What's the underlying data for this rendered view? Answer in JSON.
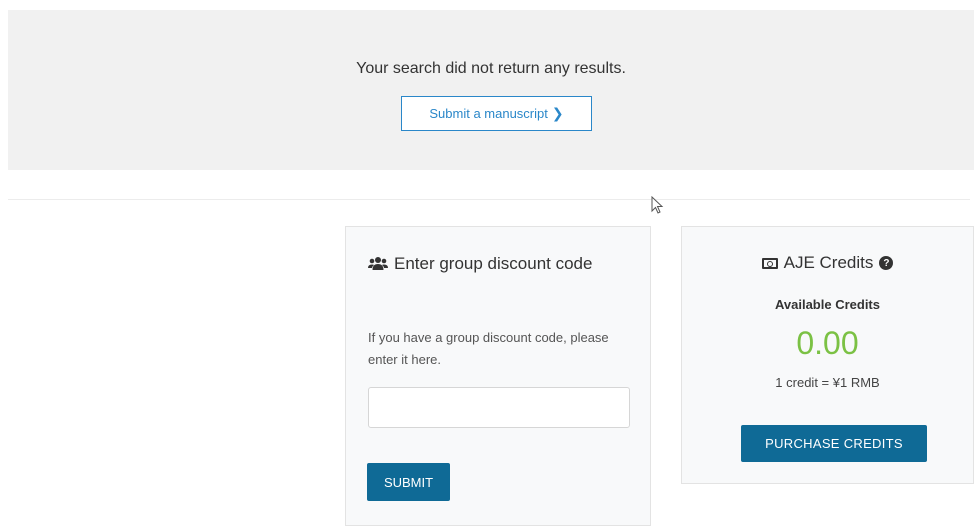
{
  "search_results": {
    "message": "Your search did not return any results.",
    "submit_manuscript_label": "Submit a manuscript",
    "chevron_icon": "chevron-right-icon"
  },
  "discount": {
    "icon": "users-icon",
    "title": "Enter group discount code",
    "description": "If you have a group discount code, please enter it here.",
    "input_value": "",
    "submit_label": "SUBMIT"
  },
  "credits": {
    "icon": "money-icon",
    "title": "AJE Credits",
    "help_icon": "question-circle-icon",
    "available_label": "Available Credits",
    "amount": "0.00",
    "rate": "1 credit = ¥1 RMB",
    "purchase_label": "PURCHASE CREDITS"
  },
  "colors": {
    "primary_button": "#0f6a96",
    "link_blue": "#2a87c9",
    "credits_green": "#7bc144",
    "panel_gray": "#f1f1f1"
  }
}
